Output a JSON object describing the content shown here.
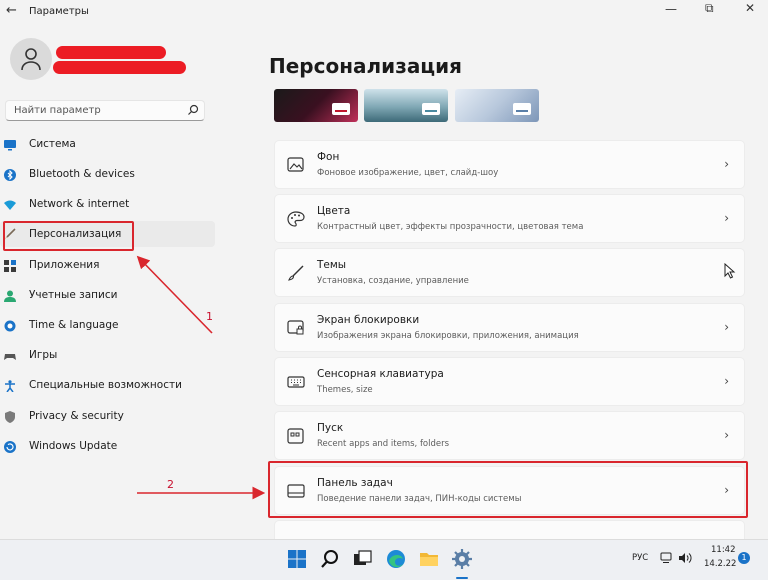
{
  "window": {
    "title": "Параметры",
    "back_glyph": "←",
    "minimize_glyph": "—",
    "maximize_glyph": "⧉",
    "close_glyph": "✕"
  },
  "search": {
    "placeholder": "Найти параметр"
  },
  "sidebar": {
    "items": [
      {
        "label": "Система",
        "icon": "monitor-icon"
      },
      {
        "label": "Bluetooth & devices",
        "icon": "bluetooth-icon"
      },
      {
        "label": "Network & internet",
        "icon": "wifi-icon"
      },
      {
        "label": "Персонализация",
        "icon": "brush-icon",
        "active": true
      },
      {
        "label": "Приложения",
        "icon": "apps-icon"
      },
      {
        "label": "Учетные записи",
        "icon": "person-icon"
      },
      {
        "label": "Time & language",
        "icon": "globe-clock-icon"
      },
      {
        "label": "Игры",
        "icon": "gamepad-icon"
      },
      {
        "label": "Специальные возможности",
        "icon": "accessibility-icon"
      },
      {
        "label": "Privacy & security",
        "icon": "shield-icon"
      },
      {
        "label": "Windows Update",
        "icon": "update-icon"
      }
    ]
  },
  "main": {
    "title": "Персонализация",
    "cards": [
      {
        "title": "Фон",
        "subtitle": "Фоновое изображение, цвет, слайд-шоу",
        "icon": "image-icon"
      },
      {
        "title": "Цвета",
        "subtitle": "Контрастный цвет, эффекты прозрачности, цветовая тема",
        "icon": "palette-icon"
      },
      {
        "title": "Темы",
        "subtitle": "Установка, создание, управление",
        "icon": "brush-icon"
      },
      {
        "title": "Экран блокировки",
        "subtitle": "Изображения экрана блокировки, приложения, анимация",
        "icon": "lock-screen-icon"
      },
      {
        "title": "Сенсорная клавиатура",
        "subtitle": "Themes, size",
        "icon": "keyboard-icon"
      },
      {
        "title": "Пуск",
        "subtitle": "Recent apps and items, folders",
        "icon": "start-icon"
      },
      {
        "title": "Панель задач",
        "subtitle": "Поведение панели задач, ПИН-коды системы",
        "icon": "taskbar-icon"
      }
    ],
    "chevron": "›"
  },
  "annotations": {
    "step1": "1",
    "step2": "2"
  },
  "taskbar": {
    "lang": "РУС",
    "time": "11:42",
    "date": "14.2.22",
    "notifications": "1"
  },
  "colors": {
    "accent": "#0067c0",
    "annotation": "#d9262d",
    "redaction": "#ec1c24"
  }
}
